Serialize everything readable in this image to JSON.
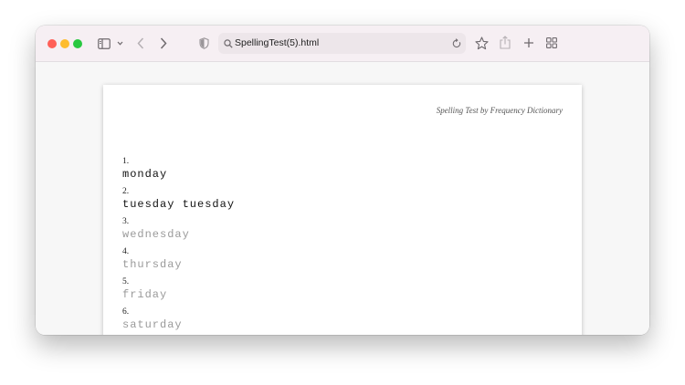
{
  "browser": {
    "url": "SpellingTest(5).html",
    "icons": [
      "sidebar-icon",
      "chevron-down-icon",
      "back-icon",
      "forward-icon",
      "shield-icon",
      "search-icon",
      "reload-icon",
      "star-icon",
      "share-icon",
      "plus-icon",
      "tab-overview-icon"
    ],
    "colors": {
      "close": "#ff5f57",
      "minimize": "#febc2e",
      "zoom": "#28c840",
      "toolbar": "#f6eff3"
    }
  },
  "page": {
    "credit": "Spelling Test by Frequency Dictionary",
    "items": [
      {
        "number": "1.",
        "word": "monday",
        "state": "done"
      },
      {
        "number": "2.",
        "word": "tuesday tuesday",
        "state": "done"
      },
      {
        "number": "3.",
        "word": "wednesday",
        "state": "pending"
      },
      {
        "number": "4.",
        "word": "thursday",
        "state": "pending"
      },
      {
        "number": "5.",
        "word": "friday",
        "state": "pending"
      },
      {
        "number": "6.",
        "word": "saturday",
        "state": "pending"
      }
    ]
  }
}
